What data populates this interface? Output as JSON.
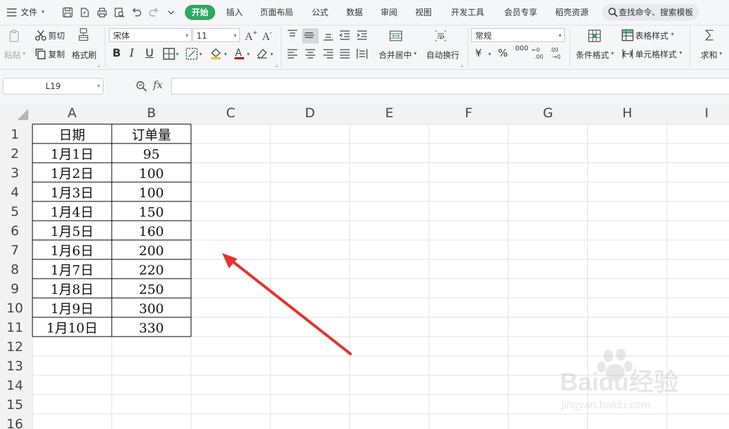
{
  "menubar": {
    "file_label": "文件",
    "tabs": [
      {
        "label": "开始",
        "active": true
      },
      {
        "label": "插入"
      },
      {
        "label": "页面布局"
      },
      {
        "label": "公式"
      },
      {
        "label": "数据"
      },
      {
        "label": "审阅"
      },
      {
        "label": "视图"
      },
      {
        "label": "开发工具"
      },
      {
        "label": "会员专享"
      },
      {
        "label": "稻壳资源"
      }
    ],
    "search_placeholder": "查找命令、搜索模板"
  },
  "ribbon": {
    "paste": "粘贴",
    "cut": "剪切",
    "copy": "复制",
    "format_painter": "格式刷",
    "font_name": "宋体",
    "font_size": "11",
    "bold": "B",
    "italic": "I",
    "underline": "U",
    "merge_center": "合并居中",
    "wrap_text": "自动换行",
    "number_format": "常规",
    "currency": "¥",
    "percent": "%",
    "thousands": "000",
    "cond_format": "条件格式",
    "table_style": "表格样式",
    "cell_style": "单元格样式",
    "sum": "求和"
  },
  "formula_bar": {
    "name_box": "L19",
    "fx": "fx",
    "formula": ""
  },
  "sheet": {
    "columns": [
      "A",
      "B",
      "C",
      "D",
      "E",
      "F",
      "G",
      "H",
      "I"
    ],
    "rows": [
      "1",
      "2",
      "3",
      "4",
      "5",
      "6",
      "7",
      "8",
      "9",
      "10",
      "11",
      "12",
      "13",
      "14",
      "15",
      "16"
    ],
    "table": {
      "headers": [
        "日期",
        "订单量"
      ],
      "rows": [
        [
          "1月1日",
          "95"
        ],
        [
          "1月2日",
          "100"
        ],
        [
          "1月3日",
          "100"
        ],
        [
          "1月4日",
          "150"
        ],
        [
          "1月5日",
          "160"
        ],
        [
          "1月6日",
          "200"
        ],
        [
          "1月7日",
          "220"
        ],
        [
          "1月8日",
          "250"
        ],
        [
          "1月9日",
          "300"
        ],
        [
          "1月10日",
          "330"
        ]
      ]
    }
  },
  "colors": {
    "accent": "#2ea862",
    "arrow": "#e8312a",
    "grid": "#e0e0e0",
    "header_bg": "#f2f2f2"
  },
  "watermark": {
    "brand": "Baidu经验",
    "url": "jingyan.baidu.com"
  }
}
